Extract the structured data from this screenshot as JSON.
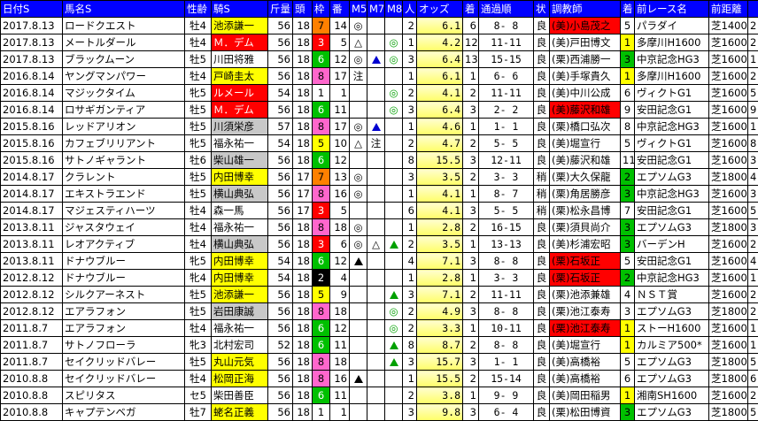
{
  "headers": [
    "日付S",
    "馬名S",
    "性齢",
    "騎S",
    "斤量",
    "頭",
    "枠",
    "番",
    "M5",
    "M7",
    "M8",
    "人",
    "オッズ",
    "着",
    "通過順",
    "状",
    "調教師",
    "着",
    "前レース名",
    "前距離",
    ""
  ],
  "gate_colors": {
    "1": "#ffffff",
    "2": "#000000",
    "3": "#ff0000",
    "4": "#0000ff",
    "5": "#ffff00",
    "6": "#00c000",
    "7": "#ff8000",
    "8": "#ff66cc"
  },
  "gate_text": {
    "1": "#000",
    "2": "#fff",
    "3": "#fff",
    "4": "#fff",
    "5": "#000",
    "6": "#fff",
    "7": "#000",
    "8": "#000"
  },
  "rows": [
    {
      "date": "2017.8.13",
      "horse": "ロードクエスト",
      "sex": "牡4",
      "jockey": "池添謙一",
      "jbg": "#ffff00",
      "jfg": "#000",
      "kin": "56",
      "heads": "18",
      "waku": "7",
      "ban": "14",
      "m5": "◎",
      "m7": "",
      "m8": "",
      "nin": "2",
      "odds": "6.1",
      "chaku": "6",
      "pass": "8- 8",
      "state": "良",
      "trainer": "(美)小島茂之",
      "tbg": "#ff0000",
      "prevc": "5",
      "prevcbg": "#ffffff",
      "race": "パラダイ",
      "rbg": "#ffffff",
      "dist": "芝1400",
      "dbg": "#ffffff",
      "tail": "2"
    },
    {
      "date": "2017.8.13",
      "horse": "メートルダール",
      "sex": "牡4",
      "jockey": "Ｍ．デム",
      "jbg": "#ff0000",
      "jfg": "#fff",
      "kin": "56",
      "heads": "18",
      "waku": "3",
      "ban": "5",
      "m5": "△",
      "m7": "",
      "m8": "◎",
      "nin": "1",
      "odds": "4.2",
      "chaku": "12",
      "pass": "11-11",
      "state": "良",
      "trainer": "(美)戸田博文",
      "tbg": "#ffffff",
      "prevc": "1",
      "prevcbg": "#ffff00",
      "race": "多摩川H1600",
      "rbg": "#ffffff",
      "dist": "芝1600",
      "dbg": "#ffffff",
      "tail": "2"
    },
    {
      "date": "2017.8.13",
      "horse": "ブラックムーン",
      "sex": "牡5",
      "jockey": "川田将雅",
      "jbg": "#ffffff",
      "jfg": "#000",
      "kin": "56",
      "heads": "18",
      "waku": "6",
      "ban": "12",
      "m5": "◎",
      "m7": "▲",
      "m8": "◎",
      "nin": "3",
      "odds": "6.4",
      "chaku": "13",
      "pass": "15-15",
      "state": "良",
      "trainer": "(栗)西浦勝一",
      "tbg": "#ffffff",
      "prevc": "3",
      "prevcbg": "#00c000",
      "race": "中京記念HG3",
      "rbg": "#ffffff",
      "dist": "芝1600",
      "dbg": "#ffffff",
      "tail": "1"
    },
    {
      "date": "2016.8.14",
      "horse": "ヤングマンパワー",
      "sex": "牡4",
      "jockey": "戸崎圭太",
      "jbg": "#ffff00",
      "jfg": "#000",
      "kin": "56",
      "heads": "18",
      "waku": "8",
      "ban": "17",
      "m5": "注",
      "m7": "",
      "m8": "",
      "nin": "1",
      "odds": "6.1",
      "chaku": "1",
      "pass": "6- 6",
      "state": "良",
      "trainer": "(美)手塚貴久",
      "tbg": "#ffffff",
      "prevc": "1",
      "prevcbg": "#ffff00",
      "race": "多摩川H1600",
      "rbg": "#ffffff",
      "dist": "芝1600",
      "dbg": "#ffffff",
      "tail": "2"
    },
    {
      "date": "2016.8.14",
      "horse": "マジックタイム",
      "sex": "牝5",
      "jockey": "ルメール",
      "jbg": "#ff0000",
      "jfg": "#fff",
      "kin": "54",
      "heads": "18",
      "waku": "1",
      "ban": "1",
      "m5": "",
      "m7": "",
      "m8": "◎",
      "nin": "2",
      "odds": "4.1",
      "chaku": "2",
      "pass": "11-11",
      "state": "良",
      "trainer": "(美)中川公成",
      "tbg": "#ffffff",
      "prevc": "6",
      "prevcbg": "#ffffff",
      "race": "ヴィクトG1",
      "rbg": "#ffffff",
      "dist": "芝1600",
      "dbg": "#ffffff",
      "tail": "5"
    },
    {
      "date": "2016.8.14",
      "horse": "ロサギガンティア",
      "sex": "牡5",
      "jockey": "Ｍ．デム",
      "jbg": "#ff0000",
      "jfg": "#fff",
      "kin": "56",
      "heads": "18",
      "waku": "6",
      "ban": "11",
      "m5": "",
      "m7": "",
      "m8": "◎",
      "nin": "3",
      "odds": "6.4",
      "chaku": "3",
      "pass": "2- 2",
      "state": "良",
      "trainer": "(美)藤沢和雄",
      "tbg": "#ff0000",
      "prevc": "9",
      "prevcbg": "#ffffff",
      "race": "安田記念G1",
      "rbg": "#ffffff",
      "dist": "芝1600",
      "dbg": "#ffffff",
      "tail": "9"
    },
    {
      "date": "2015.8.16",
      "horse": "レッドアリオン",
      "sex": "牡5",
      "jockey": "川須栄彦",
      "jbg": "#c8c8c8",
      "jfg": "#000",
      "kin": "57",
      "heads": "18",
      "waku": "8",
      "ban": "17",
      "m5": "◎",
      "m7": "▲",
      "m8": "",
      "nin": "1",
      "odds": "4.6",
      "chaku": "1",
      "pass": "1- 1",
      "state": "良",
      "trainer": "(栗)橋口弘次",
      "tbg": "#ffffff",
      "prevc": "8",
      "prevcbg": "#ffffff",
      "race": "中京記念HG3",
      "rbg": "#ffffff",
      "dist": "芝1600",
      "dbg": "#ffffff",
      "tail": "1"
    },
    {
      "date": "2015.8.16",
      "horse": "カフェブリリアント",
      "sex": "牝5",
      "jockey": "福永祐一",
      "jbg": "#ffffff",
      "jfg": "#000",
      "kin": "54",
      "heads": "18",
      "waku": "5",
      "ban": "10",
      "m5": "△",
      "m7": "注",
      "m8": "",
      "nin": "2",
      "odds": "4.7",
      "chaku": "2",
      "pass": "5- 5",
      "state": "良",
      "trainer": "(美)堀宣行",
      "tbg": "#ffffff",
      "prevc": "5",
      "prevcbg": "#ffffff",
      "race": "ヴィクトG1",
      "rbg": "#ffffff",
      "dist": "芝1600",
      "dbg": "#ffffff",
      "tail": "8"
    },
    {
      "date": "2015.8.16",
      "horse": "サトノギャラント",
      "sex": "牡6",
      "jockey": "柴山雄一",
      "jbg": "#c8c8c8",
      "jfg": "#000",
      "kin": "56",
      "heads": "18",
      "waku": "6",
      "ban": "12",
      "m5": "",
      "m7": "",
      "m8": "",
      "nin": "8",
      "odds": "15.5",
      "chaku": "3",
      "pass": "12-11",
      "state": "良",
      "trainer": "(美)藤沢和雄",
      "tbg": "#ffffff",
      "prevc": "11",
      "prevcbg": "#ffffff",
      "race": "安田記念G1",
      "rbg": "#ffffff",
      "dist": "芝1600",
      "dbg": "#ffffff",
      "tail": "3"
    },
    {
      "date": "2014.8.17",
      "horse": "クラレント",
      "sex": "牡5",
      "jockey": "内田博幸",
      "jbg": "#ffff00",
      "jfg": "#000",
      "kin": "56",
      "heads": "17",
      "waku": "7",
      "ban": "13",
      "m5": "◎",
      "m7": "",
      "m8": "",
      "nin": "3",
      "odds": "3.5",
      "chaku": "2",
      "pass": "3- 3",
      "state": "稍",
      "trainer": "(栗)大久保龍",
      "tbg": "#ffffff",
      "prevc": "2",
      "prevcbg": "#00c000",
      "race": "エプソムG3",
      "rbg": "#ffffff",
      "dist": "芝1800",
      "dbg": "#ffffff",
      "tail": "4"
    },
    {
      "date": "2014.8.17",
      "horse": "エキストラエンド",
      "sex": "牡5",
      "jockey": "横山典弘",
      "jbg": "#c8c8c8",
      "jfg": "#000",
      "kin": "56",
      "heads": "17",
      "waku": "8",
      "ban": "16",
      "m5": "◎",
      "m7": "",
      "m8": "",
      "nin": "1",
      "odds": "4.1",
      "chaku": "1",
      "pass": "8- 7",
      "state": "稍",
      "trainer": "(栗)角居勝彦",
      "tbg": "#ffffff",
      "prevc": "3",
      "prevcbg": "#00c000",
      "race": "中京記念HG3",
      "rbg": "#ffffff",
      "dist": "芝1600",
      "dbg": "#ffffff",
      "tail": "3"
    },
    {
      "date": "2014.8.17",
      "horse": "マジェスティハーツ",
      "sex": "牡4",
      "jockey": "森一馬",
      "jbg": "#ffffff",
      "jfg": "#000",
      "kin": "56",
      "heads": "17",
      "waku": "3",
      "ban": "5",
      "m5": "",
      "m7": "",
      "m8": "",
      "nin": "6",
      "odds": "4.1",
      "chaku": "3",
      "pass": "5- 5",
      "state": "稍",
      "trainer": "(栗)松永昌博",
      "tbg": "#ffffff",
      "prevc": "7",
      "prevcbg": "#ffffff",
      "race": "安田記念G1",
      "rbg": "#ffffff",
      "dist": "芝1600",
      "dbg": "#ffffff",
      "tail": "5"
    },
    {
      "date": "2013.8.11",
      "horse": "ジャスタウェイ",
      "sex": "牡4",
      "jockey": "福永祐一",
      "jbg": "#ffffff",
      "jfg": "#000",
      "kin": "56",
      "heads": "18",
      "waku": "8",
      "ban": "18",
      "m5": "◎",
      "m7": "",
      "m8": "",
      "nin": "1",
      "odds": "2.8",
      "chaku": "2",
      "pass": "16-15",
      "state": "良",
      "trainer": "(栗)須貝尚介",
      "tbg": "#ffffff",
      "prevc": "3",
      "prevcbg": "#00c000",
      "race": "エプソムG3",
      "rbg": "#ffffff",
      "dist": "芝1800",
      "dbg": "#ffffff",
      "tail": "3"
    },
    {
      "date": "2013.8.11",
      "horse": "レオアクティブ",
      "sex": "牡4",
      "jockey": "横山典弘",
      "jbg": "#c8c8c8",
      "jfg": "#000",
      "kin": "56",
      "heads": "18",
      "waku": "3",
      "ban": "6",
      "m5": "◎",
      "m7": "△",
      "m8": "▲",
      "nin": "2",
      "odds": "3.5",
      "chaku": "1",
      "pass": "13-13",
      "state": "良",
      "trainer": "(美)杉浦宏昭",
      "tbg": "#ffffff",
      "prevc": "3",
      "prevcbg": "#00c000",
      "race": "バーデンH",
      "rbg": "#ffffff",
      "dist": "芝1600",
      "dbg": "#ffffff",
      "tail": "2"
    },
    {
      "date": "2013.8.11",
      "horse": "ドナウブルー",
      "sex": "牝5",
      "jockey": "内田博幸",
      "jbg": "#ffff00",
      "jfg": "#000",
      "kin": "54",
      "heads": "18",
      "waku": "6",
      "ban": "12",
      "m5": "▲",
      "m7": "",
      "m8": "",
      "nin": "4",
      "odds": "7.1",
      "chaku": "3",
      "pass": "8- 8",
      "state": "良",
      "trainer": "(栗)石坂正",
      "tbg": "#ff0000",
      "prevc": "5",
      "prevcbg": "#ffffff",
      "race": "安田記念G1",
      "rbg": "#ffffff",
      "dist": "芝1600",
      "dbg": "#ffffff",
      "tail": "4"
    },
    {
      "date": "2012.8.12",
      "horse": "ドナウブルー",
      "sex": "牝4",
      "jockey": "内田博幸",
      "jbg": "#ffff00",
      "jfg": "#000",
      "kin": "54",
      "heads": "18",
      "waku": "2",
      "ban": "4",
      "m5": "",
      "m7": "",
      "m8": "",
      "nin": "1",
      "odds": "2.8",
      "chaku": "1",
      "pass": "3- 3",
      "state": "良",
      "trainer": "(栗)石坂正",
      "tbg": "#ff0000",
      "prevc": "2",
      "prevcbg": "#00c000",
      "race": "中京記念HG3",
      "rbg": "#ffffff",
      "dist": "芝1600",
      "dbg": "#ffffff",
      "tail": "1"
    },
    {
      "date": "2012.8.12",
      "horse": "シルクアーネスト",
      "sex": "牡5",
      "jockey": "池添謙一",
      "jbg": "#ffff00",
      "jfg": "#000",
      "kin": "56",
      "heads": "18",
      "waku": "5",
      "ban": "9",
      "m5": "",
      "m7": "",
      "m8": "▲",
      "nin": "3",
      "odds": "7.1",
      "chaku": "2",
      "pass": "11-11",
      "state": "良",
      "trainer": "(栗)池添兼雄",
      "tbg": "#ffffff",
      "prevc": "4",
      "prevcbg": "#ffffff",
      "race": "ＮＳＴ賞",
      "rbg": "#ffffff",
      "dist": "芝1600",
      "dbg": "#ffffff",
      "tail": "2"
    },
    {
      "date": "2012.8.12",
      "horse": "エアラフォン",
      "sex": "牡5",
      "jockey": "岩田康誠",
      "jbg": "#c8c8c8",
      "jfg": "#000",
      "kin": "56",
      "heads": "18",
      "waku": "8",
      "ban": "18",
      "m5": "",
      "m7": "",
      "m8": "◎",
      "nin": "2",
      "odds": "4.9",
      "chaku": "3",
      "pass": "8- 8",
      "state": "良",
      "trainer": "(栗)池江泰寿",
      "tbg": "#ffffff",
      "prevc": "3",
      "prevcbg": "#ffffff",
      "race": "エプソムG3",
      "rbg": "#ffffff",
      "dist": "芝1800",
      "dbg": "#ffffff",
      "tail": "2"
    },
    {
      "date": "2011.8.7",
      "horse": "エアラフォン",
      "sex": "牡4",
      "jockey": "福永祐一",
      "jbg": "#ffffff",
      "jfg": "#000",
      "kin": "56",
      "heads": "18",
      "waku": "6",
      "ban": "12",
      "m5": "",
      "m7": "",
      "m8": "◎",
      "nin": "2",
      "odds": "3.3",
      "chaku": "1",
      "pass": "10-11",
      "state": "良",
      "trainer": "(栗)池江泰寿",
      "tbg": "#ff0000",
      "prevc": "1",
      "prevcbg": "#ffff00",
      "race": "ストーH1600",
      "rbg": "#ffffff",
      "dist": "芝1600",
      "dbg": "#ffffff",
      "tail": "1"
    },
    {
      "date": "2011.8.7",
      "horse": "サトノフローラ",
      "sex": "牝3",
      "jockey": "北村宏司",
      "jbg": "#ffffff",
      "jfg": "#000",
      "kin": "52",
      "heads": "18",
      "waku": "6",
      "ban": "11",
      "m5": "",
      "m7": "",
      "m8": "▲",
      "nin": "8",
      "odds": "8.7",
      "chaku": "2",
      "pass": "8- 8",
      "state": "良",
      "trainer": "(美)堀宣行",
      "tbg": "#ffffff",
      "prevc": "1",
      "prevcbg": "#ffff00",
      "race": "カルミア500*",
      "rbg": "#ffffff",
      "dist": "芝1600",
      "dbg": "#ffffff",
      "tail": "1"
    },
    {
      "date": "2011.8.7",
      "horse": "セイクリッドバレー",
      "sex": "牡5",
      "jockey": "丸山元気",
      "jbg": "#ffff00",
      "jfg": "#000",
      "kin": "56",
      "heads": "18",
      "waku": "8",
      "ban": "18",
      "m5": "",
      "m7": "",
      "m8": "▲",
      "nin": "3",
      "odds": "15.7",
      "chaku": "3",
      "pass": "1- 1",
      "state": "良",
      "trainer": "(美)高橋裕",
      "tbg": "#ffffff",
      "prevc": "5",
      "prevcbg": "#ffffff",
      "race": "エプソムG3",
      "rbg": "#ffffff",
      "dist": "芝1800",
      "dbg": "#ffffff",
      "tail": "5"
    },
    {
      "date": "2010.8.8",
      "horse": "セイクリッドバレー",
      "sex": "牡4",
      "jockey": "松岡正海",
      "jbg": "#ffff00",
      "jfg": "#000",
      "kin": "56",
      "heads": "18",
      "waku": "8",
      "ban": "16",
      "m5": "▲",
      "m7": "",
      "m8": "",
      "nin": "1",
      "odds": "15.5",
      "chaku": "2",
      "pass": "15-14",
      "state": "良",
      "trainer": "(美)高橋裕",
      "tbg": "#ffffff",
      "prevc": "6",
      "prevcbg": "#ffffff",
      "race": "エプソムG3",
      "rbg": "#ffffff",
      "dist": "芝1800",
      "dbg": "#ffffff",
      "tail": "6"
    },
    {
      "date": "2010.8.8",
      "horse": "スピリタス",
      "sex": "セ5",
      "jockey": "柴田善臣",
      "jbg": "#ffffff",
      "jfg": "#000",
      "kin": "56",
      "heads": "18",
      "waku": "6",
      "ban": "11",
      "m5": "",
      "m7": "",
      "m8": "",
      "nin": "2",
      "odds": "3.8",
      "chaku": "1",
      "pass": "9- 9",
      "state": "良",
      "trainer": "(美)岡田稲男",
      "tbg": "#ffffff",
      "prevc": "1",
      "prevcbg": "#ffff00",
      "race": "湘南SH1600",
      "rbg": "#ffffff",
      "dist": "芝1600",
      "dbg": "#ffffff",
      "tail": "2"
    },
    {
      "date": "2010.8.8",
      "horse": "キャプテンベガ",
      "sex": "牡7",
      "jockey": "蛯名正義",
      "jbg": "#ffff00",
      "jfg": "#000",
      "kin": "56",
      "heads": "18",
      "waku": "1",
      "ban": "1",
      "m5": "",
      "m7": "",
      "m8": "",
      "nin": "3",
      "odds": "9.8",
      "chaku": "3",
      "pass": "6- 4",
      "state": "良",
      "trainer": "(栗)松田博資",
      "tbg": "#ffffff",
      "prevc": "3",
      "prevcbg": "#00c000",
      "race": "エプソムG3",
      "rbg": "#ffffff",
      "dist": "芝1800",
      "dbg": "#ffffff",
      "tail": "5"
    }
  ]
}
